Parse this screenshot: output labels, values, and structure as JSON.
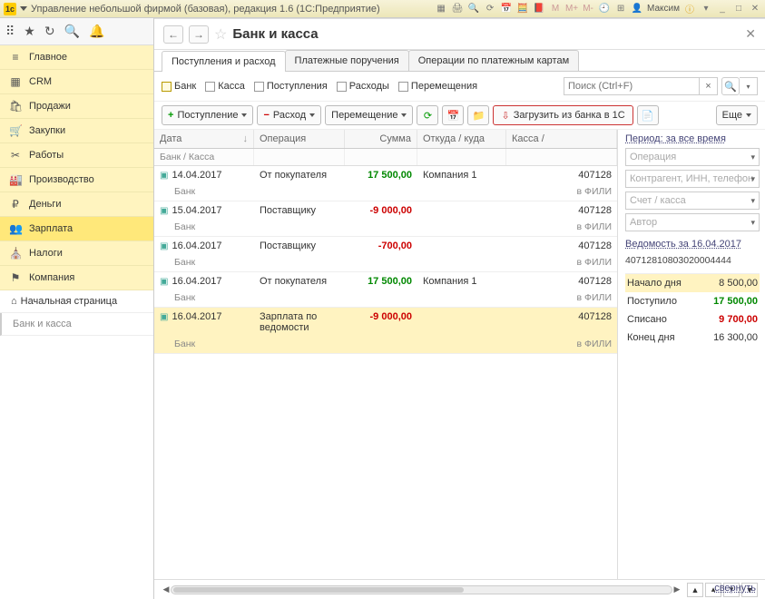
{
  "window": {
    "title": "Управление небольшой фирмой (базовая), редакция 1.6  (1С:Предприятие)",
    "user": "Максим"
  },
  "sidebar": {
    "items": [
      {
        "icon": "≡",
        "label": "Главное"
      },
      {
        "icon": "▦",
        "label": "CRM"
      },
      {
        "icon": "🛍",
        "label": "Продажи"
      },
      {
        "icon": "🛒",
        "label": "Закупки"
      },
      {
        "icon": "✂",
        "label": "Работы"
      },
      {
        "icon": "🏭",
        "label": "Производство"
      },
      {
        "icon": "₽",
        "label": "Деньги"
      },
      {
        "icon": "👥",
        "label": "Зарплата"
      },
      {
        "icon": "⛪",
        "label": "Налоги"
      },
      {
        "icon": "⚑",
        "label": "Компания"
      }
    ],
    "sub": [
      {
        "label": "Начальная страница"
      },
      {
        "label": "Банк и касса"
      }
    ]
  },
  "page": {
    "title": "Банк и касса",
    "tabs": [
      "Поступления и расход",
      "Платежные поручения",
      "Операции по платежным картам"
    ]
  },
  "filters": {
    "bank": "Банк",
    "cash": "Касса",
    "income": "Поступления",
    "expense": "Расходы",
    "move": "Перемещения",
    "search_placeholder": "Поиск (Ctrl+F)"
  },
  "toolbar": {
    "income": "Поступление",
    "expense": "Расход",
    "move": "Перемещение",
    "load": "Загрузить из банка в 1С",
    "more": "Еще"
  },
  "grid": {
    "headers": {
      "date": "Дата",
      "op": "Операция",
      "sum": "Сумма",
      "where": "Откуда / куда",
      "acc": "Касса /"
    },
    "subheaders": {
      "date": "Банк / Касса"
    },
    "rows": [
      {
        "date": "14.04.2017",
        "bank": "Банк",
        "op": "От покупателя",
        "sum": "17 500,00",
        "sign": "pos",
        "where": "Компания 1",
        "acc": "407128",
        "acc2": "в ФИЛИ"
      },
      {
        "date": "15.04.2017",
        "bank": "Банк",
        "op": "Поставщику",
        "sum": "-9 000,00",
        "sign": "neg",
        "where": "",
        "acc": "407128",
        "acc2": "в ФИЛИ"
      },
      {
        "date": "16.04.2017",
        "bank": "Банк",
        "op": "Поставщику",
        "sum": "-700,00",
        "sign": "neg",
        "where": "",
        "acc": "407128",
        "acc2": "в ФИЛИ"
      },
      {
        "date": "16.04.2017",
        "bank": "Банк",
        "op": "От покупателя",
        "sum": "17 500,00",
        "sign": "pos",
        "where": "Компания 1",
        "acc": "407128",
        "acc2": "в ФИЛИ"
      },
      {
        "date": "16.04.2017",
        "bank": "Банк",
        "op": "Зарплата по ведомости",
        "sum": "-9 000,00",
        "sign": "neg",
        "where": "",
        "acc": "407128",
        "acc2": "в ФИЛИ",
        "selected": true
      }
    ]
  },
  "side": {
    "period": "Период: за все время",
    "op_placeholder": "Операция",
    "contr_placeholder": "Контрагент, ИНН, телефон",
    "acc_placeholder": "Счет / касса",
    "author_placeholder": "Автор",
    "ved_title": "Ведомость за 16.04.2017",
    "acct": "40712810803020004444",
    "summary": [
      {
        "label": "Начало дня",
        "val": "8 500,00",
        "cls": "",
        "hl": true
      },
      {
        "label": "Поступило",
        "val": "17 500,00",
        "cls": "pos"
      },
      {
        "label": "Списано",
        "val": "9 700,00",
        "cls": "neg"
      },
      {
        "label": "Конец дня",
        "val": "16 300,00",
        "cls": ""
      }
    ],
    "collapse": "свернуть"
  }
}
